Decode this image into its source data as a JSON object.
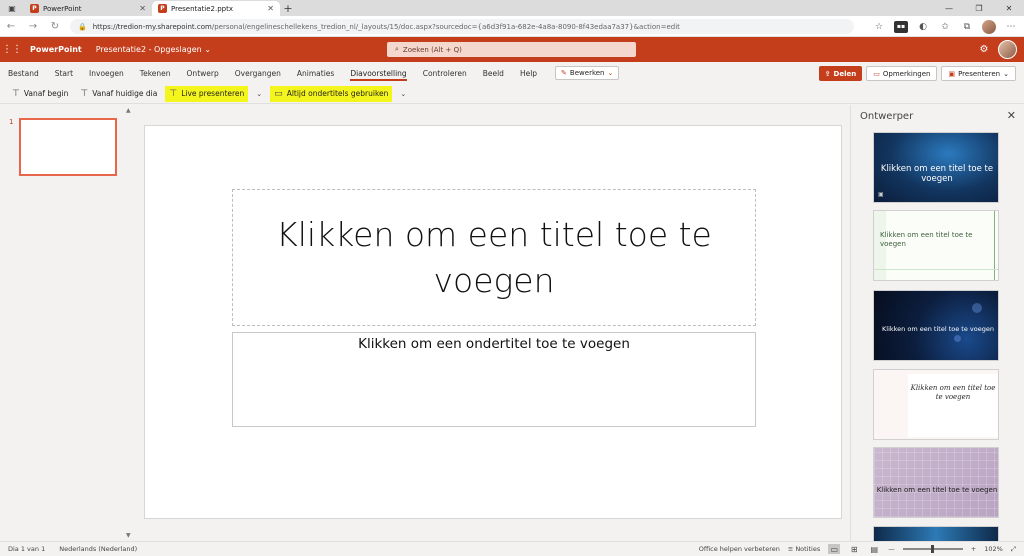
{
  "browser": {
    "tabs": [
      {
        "label": "PowerPoint",
        "active": false
      },
      {
        "label": "Presentatie2.pptx",
        "active": true
      }
    ],
    "url_host": "https://tredion-my.sharepoint.com",
    "url_path": "/personal/engelineschellekens_tredion_nl/_layouts/15/doc.aspx?sourcedoc={a6d3f91a-682e-4a8a-8090-8f43edaa7a37}&action=edit"
  },
  "app": {
    "name": "PowerPoint",
    "document": "Presentatie2 - Opgeslagen",
    "search_placeholder": "Zoeken (Alt + Q)"
  },
  "ribbon": {
    "tabs": [
      "Bestand",
      "Start",
      "Invoegen",
      "Tekenen",
      "Ontwerp",
      "Overgangen",
      "Animaties",
      "Diavoorstelling",
      "Controleren",
      "Beeld",
      "Help"
    ],
    "active_tab": "Diavoorstelling",
    "edit_mode": "Bewerken",
    "share": "Delen",
    "comments": "Opmerkingen",
    "present": "Presenteren",
    "commands": {
      "from_start": "Vanaf begin",
      "from_current": "Vanaf huidige dia",
      "live_present": "Live presenteren",
      "subtitles": "Altijd ondertitels gebruiken"
    }
  },
  "slides": {
    "number": "1"
  },
  "slide": {
    "title": "Klikken om een titel toe te voegen",
    "subtitle": "Klikken om een ondertitel toe te voegen"
  },
  "designer": {
    "title": "Ontwerper",
    "thumb1_title": "Klikken om een titel toe te voegen",
    "thumb2_title": "Klikken om een titel toe te voegen",
    "thumb3_title": "Klikken om een titel toe te voegen",
    "thumb4_title": "Klikken om een titel toe te voegen",
    "thumb5_title": "Klikken om een titel toe te voegen"
  },
  "status": {
    "slide_count": "Dia 1 van 1",
    "language": "Nederlands (Nederland)",
    "improve": "Office helpen verbeteren",
    "notes": "Notities",
    "zoom": "102%"
  },
  "colors": {
    "accent": "#c43e1c",
    "highlight": "#f5f51e"
  }
}
